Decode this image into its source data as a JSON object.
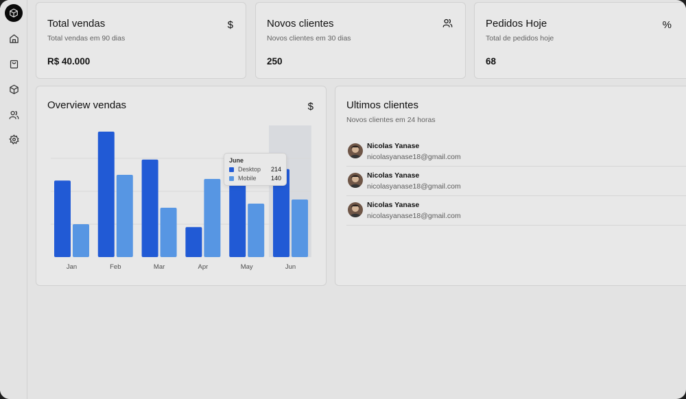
{
  "sidebar": {
    "logo_icon": "box-icon",
    "items": [
      {
        "name": "home",
        "icon": "home-icon"
      },
      {
        "name": "orders",
        "icon": "shopping-bag-icon"
      },
      {
        "name": "products",
        "icon": "package-icon"
      },
      {
        "name": "customers",
        "icon": "users-icon"
      },
      {
        "name": "settings",
        "icon": "gear-icon"
      }
    ]
  },
  "stats": [
    {
      "title": "Total vendas",
      "subtitle": "Total vendas em 90 dias",
      "value": "R$ 40.000",
      "icon": "$"
    },
    {
      "title": "Novos clientes",
      "subtitle": "Novos clientes em 30 dias",
      "value": "250",
      "icon": "users-icon"
    },
    {
      "title": "Pedidos Hoje",
      "subtitle": "Total de pedidos hoje",
      "value": "68",
      "icon": "%"
    }
  ],
  "overview": {
    "title": "Overview vendas",
    "icon": "$"
  },
  "chart_data": {
    "type": "bar",
    "categories": [
      "Jan",
      "Feb",
      "Mar",
      "Apr",
      "May",
      "Jun"
    ],
    "series": [
      {
        "name": "Desktop",
        "values": [
          186,
          305,
          237,
          73,
          209,
          214
        ],
        "color": "#2563eb"
      },
      {
        "name": "Mobile",
        "values": [
          80,
          200,
          120,
          190,
          130,
          140
        ],
        "color": "#60a5fa"
      }
    ],
    "ylim": [
      0,
      320
    ],
    "grid": true,
    "highlighted_category": "Jun",
    "tooltip": {
      "title": "June",
      "rows": [
        {
          "label": "Desktop",
          "value": "214"
        },
        {
          "label": "Mobile",
          "value": "140"
        }
      ]
    }
  },
  "clients": {
    "title": "Ultimos clientes",
    "subtitle": "Novos clientes em 24 horas",
    "items": [
      {
        "name": "Nicolas Yanase",
        "email": "nicolasyanase18@gmail.com"
      },
      {
        "name": "Nicolas Yanase",
        "email": "nicolasyanase18@gmail.com"
      },
      {
        "name": "Nicolas Yanase",
        "email": "nicolasyanase18@gmail.com"
      }
    ]
  }
}
